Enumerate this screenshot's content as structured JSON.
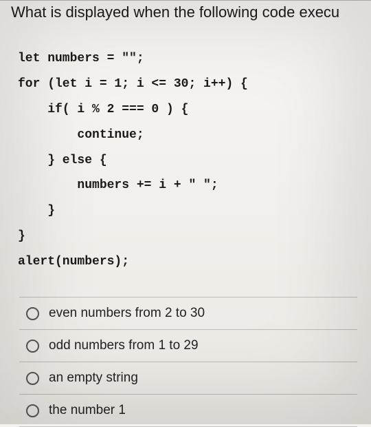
{
  "question": "What is displayed when the following code execu",
  "code": {
    "l1": "let numbers = \"\";",
    "l2": "for (let i = 1; i <= 30; i++) {",
    "l3": "    if( i % 2 === 0 ) {",
    "l4": "        continue;",
    "l5": "    } else {",
    "l6": "        numbers += i + \" \";",
    "l7": "    }",
    "l8": "}",
    "l9": "alert(numbers);"
  },
  "answers": {
    "a1": "even numbers from 2 to 30",
    "a2": "odd numbers from 1 to 29",
    "a3": "an empty string",
    "a4": "the number 1"
  }
}
